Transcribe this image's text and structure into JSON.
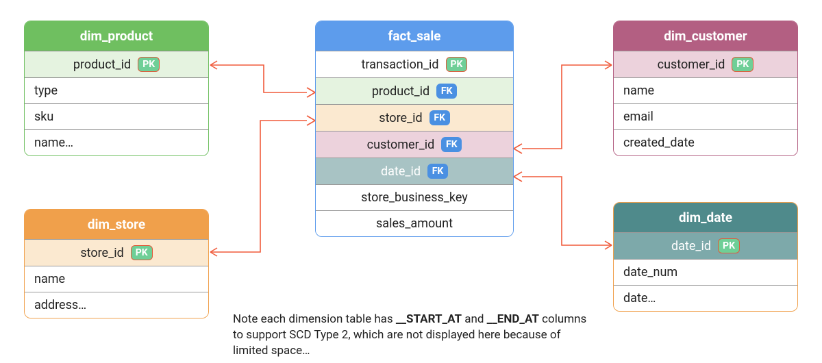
{
  "tables": {
    "dim_product": {
      "title": "dim_product",
      "rows": [
        {
          "label": "product_id",
          "badge": "PK"
        },
        {
          "label": "type"
        },
        {
          "label": "sku"
        },
        {
          "label": "name…"
        }
      ]
    },
    "fact_sale": {
      "title": "fact_sale",
      "rows": [
        {
          "label": "transaction_id",
          "badge": "PK"
        },
        {
          "label": "product_id",
          "badge": "FK",
          "tint": "green"
        },
        {
          "label": "store_id",
          "badge": "FK",
          "tint": "orange"
        },
        {
          "label": "customer_id",
          "badge": "FK",
          "tint": "mauve"
        },
        {
          "label": "date_id",
          "badge": "FK",
          "tint": "teal"
        },
        {
          "label": "store_business_key"
        },
        {
          "label": "sales_amount"
        }
      ]
    },
    "dim_customer": {
      "title": "dim_customer",
      "rows": [
        {
          "label": "customer_id",
          "badge": "PK"
        },
        {
          "label": "name"
        },
        {
          "label": "email"
        },
        {
          "label": "created_date"
        }
      ]
    },
    "dim_store": {
      "title": "dim_store",
      "rows": [
        {
          "label": "store_id",
          "badge": "PK"
        },
        {
          "label": "name"
        },
        {
          "label": "address…"
        }
      ]
    },
    "dim_date": {
      "title": "dim_date",
      "rows": [
        {
          "label": "date_id",
          "badge": "PK"
        },
        {
          "label": "date_num"
        },
        {
          "label": "date…"
        }
      ]
    }
  },
  "note": {
    "prefix": "Note each dimension table has ",
    "b1": "__START_AT",
    "mid": " and ",
    "b2": "__END_AT",
    "suffix": " columns to support SCD Type 2, which are not displayed here because of limited space…"
  },
  "badges": {
    "PK": "PK",
    "FK": "FK"
  }
}
